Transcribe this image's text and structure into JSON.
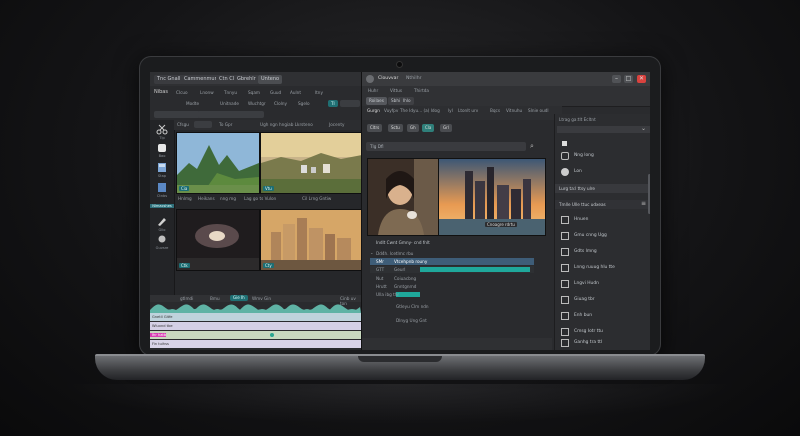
{
  "left_app": {
    "menu_tabs": [
      "Tnc Gnall",
      "Cammenmunmn",
      "Ctn Cls",
      "Gbrehlr",
      "Unteno"
    ],
    "toolbar_row1": [
      "Nibas",
      "Clcuo",
      "Lnonw",
      "Tnnyu",
      "Sqam",
      "Guud",
      "Aulnt",
      "ltny"
    ],
    "toolbar_row2": [
      "Modte",
      "Unitnade",
      "Wuchtgr",
      "Clolny",
      "Sgelo",
      "Tl"
    ],
    "grid_header": [
      "Cfsgu",
      "To Gpr",
      "Ugh ngn hngiab Lkrsteno",
      "Jocenty"
    ],
    "sidebar_labels": [
      "Tlp",
      "Bao",
      "Stap",
      "Ctnbs",
      "Nlmacshes",
      "Gllo",
      "Guvsre"
    ],
    "thumbnails": [
      {
        "scene": "mountains",
        "badge": "Cia"
      },
      {
        "scene": "town",
        "badge": "Vtu"
      },
      {
        "scene": "storm",
        "badge": "Ctk"
      },
      {
        "scene": "city",
        "badge": "Cty"
      }
    ],
    "caption_row": [
      "Hnlmg",
      "Heikans",
      "nng mg",
      "Lag go ts Vulon",
      "Cil Lrng Gntiw"
    ],
    "wave_labels": [
      "gtlmdi",
      "Bmu",
      "Gie Ih",
      "Wmv Gin",
      "Cinb uv ton"
    ],
    "tracks": [
      {
        "name": "Gnetll Gitfe",
        "color": "#7fa0b8"
      },
      {
        "name": "Wluxnd tbe",
        "color": "#8f86b0"
      },
      {
        "name": "Ihr hatb",
        "color": "#d83fb4"
      },
      {
        "name": "Fin tuihss",
        "color": "#c7c2d6"
      }
    ]
  },
  "right_app": {
    "title": "Clouvvar",
    "subtitle": "Nthilhr",
    "menu_items": [
      "Huhr",
      "Vittus",
      "Thirtda"
    ],
    "tabs": [
      "Roilaes",
      "Sbhi",
      "Ihlo"
    ],
    "toolbar": [
      "Gurgn",
      "Vuyfpv",
      "The Idyu... (a) Idog",
      "lyl",
      "Ltonlt urv",
      "Bqcs",
      "Vitnuhu",
      "Slnie oudl"
    ],
    "buttons": [
      "Cltrs",
      "Sctu",
      "Gh",
      "Cla",
      "Grl"
    ],
    "search_placeholder": "Tlg Dfl",
    "preview_badge": "Cnoagre rdrtu",
    "tree_title": "Indlt Cwnt Gmny- cnd fnlt",
    "tree_rows": [
      {
        "label": "Dd4h. lcetlmc rbu",
        "sub": "",
        "highlight": false
      },
      {
        "label": "SMr",
        "sub": "Vtcehpnb rouny",
        "highlight": true
      },
      {
        "label": "GTT",
        "sub": "Geurl",
        "highlight": true
      },
      {
        "label": "Nut",
        "sub": "Coiuacbng",
        "highlight": false
      },
      {
        "label": "Hrutt",
        "sub": "Gnntgnrnd",
        "highlight": false
      },
      {
        "label": "Ulla ibg thr",
        "sub": "",
        "highlight": false
      }
    ],
    "tree_bottom": [
      "Gtleyu Clm ndn",
      "Dlnyg Ung Gnt"
    ],
    "panel": {
      "header": "Ltrag ga:tlt Ecltnt",
      "top_items": [
        "Nng long",
        "Lon"
      ],
      "section": "Lurg ta:l ttsy ulre",
      "section2": "Tmlle Ulle ttuc udxeas",
      "items": [
        "Hnuen",
        "Gmu cnng Ugg",
        "Gdts lmng",
        "Lnng ruuug hlu tte",
        "Lngvi Hudn",
        "Giuag tbr",
        "Enh bun",
        "Cmsg Iotr ttu",
        "Ganhg tra ttl"
      ]
    }
  },
  "colors": {
    "accent": "#1fa89b",
    "close": "#d9423e",
    "track_pink": "#d83fb4"
  }
}
